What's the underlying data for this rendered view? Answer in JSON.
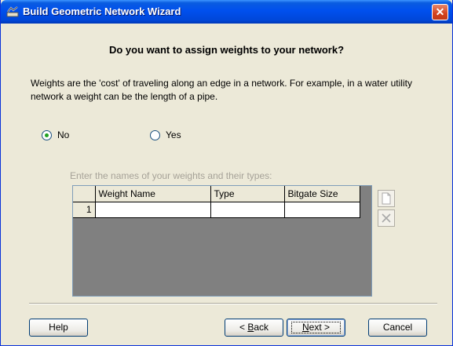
{
  "window": {
    "title": "Build Geometric Network Wizard",
    "close_label": "✕"
  },
  "heading": "Do you want to assign weights to your network?",
  "description": "Weights are the 'cost' of traveling along an edge in a network. For example, in a water utility network a weight can be the length of a pipe.",
  "options": {
    "no_label": "No",
    "yes_label": "Yes",
    "selected": "No"
  },
  "weights_grid": {
    "caption": "Enter the names of your weights and their types:",
    "columns": [
      "Weight Name",
      "Type",
      "Bitgate Size"
    ],
    "rows": [
      {
        "index": "1",
        "cells": [
          "",
          "",
          ""
        ]
      }
    ]
  },
  "buttons": {
    "help": "Help",
    "back_prefix": "< ",
    "back_underlined": "B",
    "back_rest": "ack",
    "next_underlined": "N",
    "next_rest": "ext >",
    "cancel": "Cancel"
  },
  "icons": {
    "new_row": "new-document-icon",
    "delete_row": "delete-x-icon"
  },
  "colors": {
    "titlebar": "#0050EE",
    "dialog_bg": "#ECE9D8",
    "radio_dot": "#21A121",
    "grid_bg": "#808080"
  }
}
